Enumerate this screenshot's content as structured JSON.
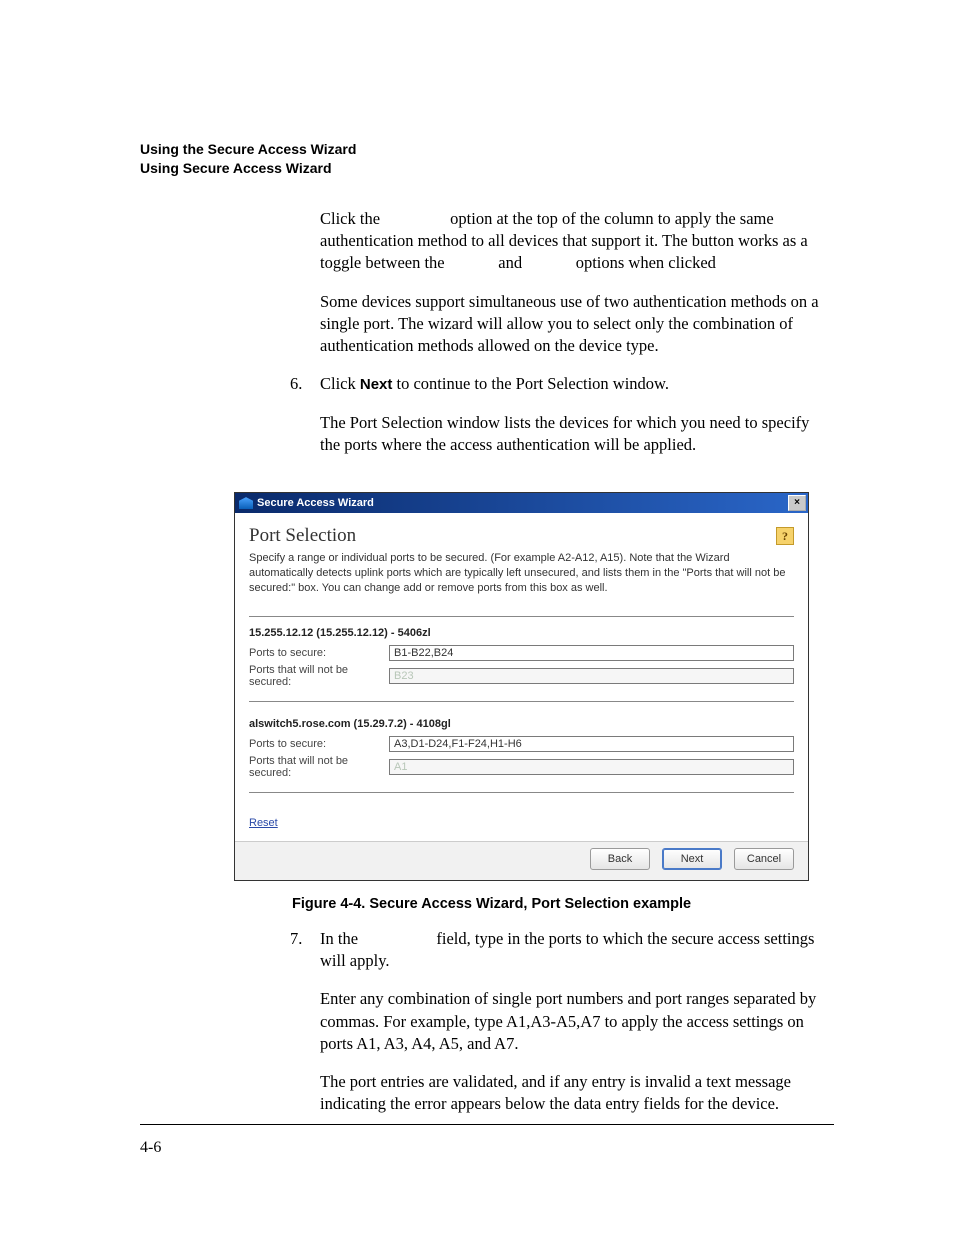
{
  "running_header": {
    "line1": "Using the Secure Access Wizard",
    "line2": "Using Secure Access Wizard"
  },
  "para_a": "Click the                 option at the top of the column to apply the same authentication method to all devices that support it. The button works as a toggle between the             and             options when clicked",
  "para_b": "Some devices support simultaneous use of two authentication methods on a single port. The wizard will allow you to select only the combination of authentication methods allowed on the device type.",
  "step6": {
    "num": "6.",
    "text_pre": "Click ",
    "bold": "Next",
    "text_post": " to continue to the Port Selection window."
  },
  "para_c": "The Port Selection window lists the devices for which you need to specify the ports where the access authentication will be applied.",
  "wizard": {
    "title": "Secure Access Wizard",
    "close": "×",
    "heading": "Port Selection",
    "help": "?",
    "intro": "Specify a range or individual ports to be secured. (For example A2-A12, A15). Note that the Wizard automatically detects uplink ports which are typically left unsecured, and lists them in the \"Ports that will not be secured:\" box. You can change add or remove ports from this box as well.",
    "devices": [
      {
        "title": "15.255.12.12 (15.255.12.12) - 5406zl",
        "secure_label": "Ports to secure:",
        "secure_value": "B1-B22,B24",
        "unsecure_label": "Ports that will not be secured:",
        "unsecure_placeholder": "B23"
      },
      {
        "title": "alswitch5.rose.com (15.29.7.2) - 4108gl",
        "secure_label": "Ports to secure:",
        "secure_value": "A3,D1-D24,F1-F24,H1-H6",
        "unsecure_label": "Ports that will not be secured:",
        "unsecure_placeholder": "A1"
      }
    ],
    "reset": "Reset",
    "buttons": {
      "back": "Back",
      "next": "Next",
      "cancel": "Cancel"
    }
  },
  "figcap": "Figure 4-4. Secure Access Wizard, Port Selection example",
  "step7": {
    "num": "7.",
    "text_pre": "In the                   field, type in the ports to which the secure access settings will apply."
  },
  "para_d": "Enter any combination of single port numbers and port ranges separated by commas. For example, type A1,A3-A5,A7 to apply the access settings on ports A1, A3, A4, A5, and A7.",
  "para_e": "The port entries are validated, and if any entry is invalid a text message indicating the error appears below the data entry fields for the device.",
  "pagenum": "4-6"
}
